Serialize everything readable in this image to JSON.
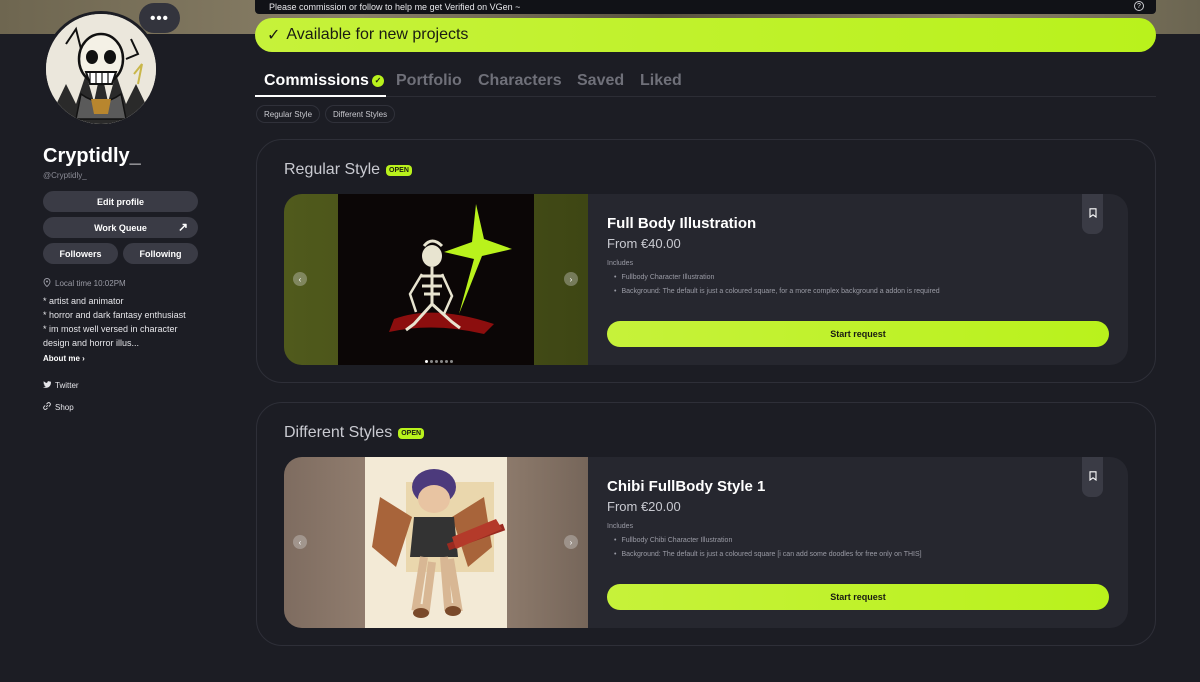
{
  "profile": {
    "more_label": "•••",
    "username": "Cryptidly_",
    "handle": "@Cryptidly_",
    "edit_profile": "Edit profile",
    "work_queue": "Work Queue",
    "followers": "Followers",
    "following": "Following",
    "local_time": "Local time 10:02PM",
    "bio": [
      "* artist and animator",
      "* horror and dark fantasy enthusiast",
      "* im most well versed in character design and horror illus..."
    ],
    "about_me": "About me",
    "twitter": "Twitter",
    "shop": "Shop"
  },
  "notice": {
    "text": "Please commission or follow to help me get Verified on VGen ~",
    "help": "?"
  },
  "availability": {
    "check": "✓",
    "text": "Available for new projects"
  },
  "tabs": [
    "Commissions",
    "Portfolio",
    "Characters",
    "Saved",
    "Liked"
  ],
  "chips": [
    "Regular Style",
    "Different Styles"
  ],
  "sections": [
    {
      "title": "Regular Style",
      "badge": "OPEN",
      "card": {
        "title": "Full Body Illustration",
        "price": "From €40.00",
        "includes_label": "Includes",
        "includes": [
          "Fullbody Character Illustration",
          "Background: The default is just a coloured square, for a more complex background a addon is required"
        ],
        "start_label": "Start request"
      }
    },
    {
      "title": "Different Styles",
      "badge": "OPEN",
      "card": {
        "title": "Chibi FullBody Style 1",
        "price": "From €20.00",
        "includes_label": "Includes",
        "includes": [
          "Fullbody Chibi Character Illustration",
          "Background: The default is just a coloured square [i can add some doodles for free only on THIS]"
        ],
        "start_label": "Start request"
      }
    }
  ],
  "icons": {
    "prev": "‹",
    "next": "›",
    "arrow": "↗",
    "chevron": "›"
  },
  "colors": {
    "accent": "#b9f21c",
    "background": "#1c1d24",
    "card": "#26272f"
  }
}
